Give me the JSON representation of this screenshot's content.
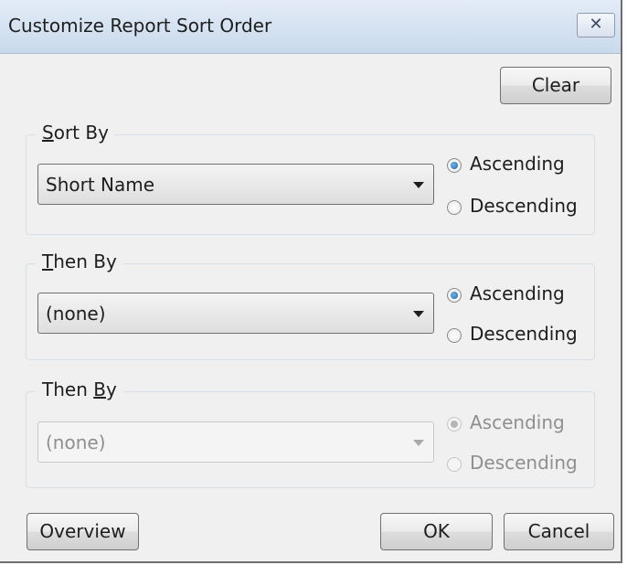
{
  "window": {
    "title": "Customize Report Sort Order",
    "close_icon": "close-icon"
  },
  "toolbar": {
    "clear_label": "Clear"
  },
  "groups": [
    {
      "legend_prefix": "",
      "legend_accel": "S",
      "legend_suffix": "ort By",
      "selected": "Short Name",
      "enabled": true,
      "ascending_label": "Ascending",
      "descending_label": "Descending",
      "order": "Ascending"
    },
    {
      "legend_prefix": "",
      "legend_accel": "T",
      "legend_suffix": "hen By",
      "selected": "(none)",
      "enabled": true,
      "ascending_label": "Ascending",
      "descending_label": "Descending",
      "order": "Ascending"
    },
    {
      "legend_prefix": "Then ",
      "legend_accel": "B",
      "legend_suffix": "y",
      "selected": "(none)",
      "enabled": false,
      "ascending_label": "Ascending",
      "descending_label": "Descending",
      "order": "Ascending"
    }
  ],
  "footer": {
    "overview_label": "Overview",
    "ok_label": "OK",
    "cancel_label": "Cancel"
  }
}
